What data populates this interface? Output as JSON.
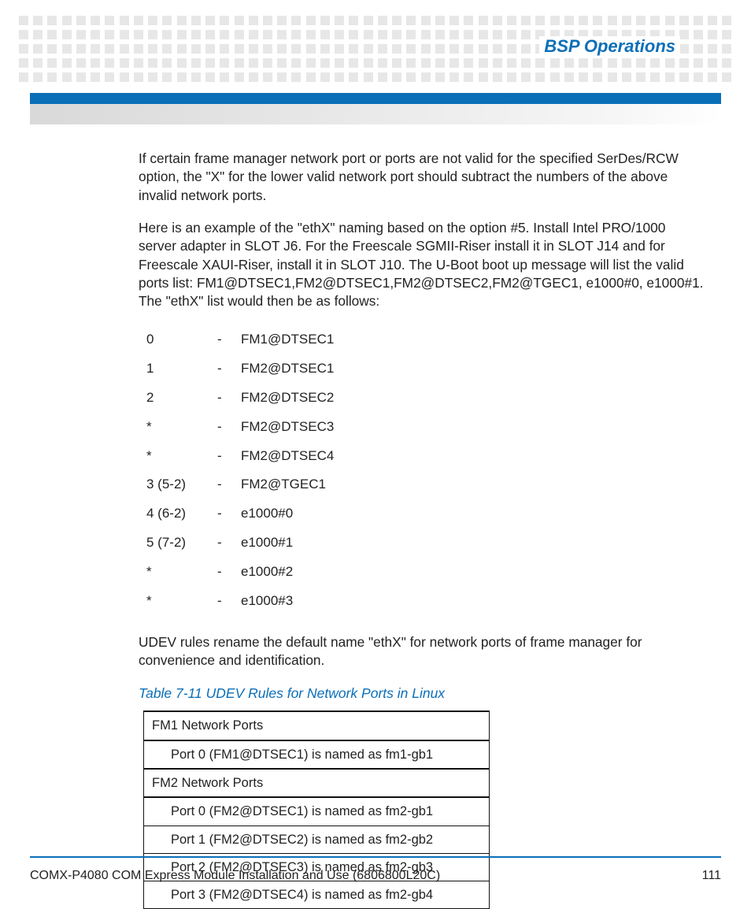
{
  "header": {
    "title": "BSP Operations"
  },
  "body": {
    "para1": "If certain frame manager network port or ports are not valid for the specified SerDes/RCW option, the \"X\" for the lower valid network port should subtract the numbers of the above invalid network ports.",
    "para2": "Here is an example of the \"ethX\" naming based on the option #5. Install Intel PRO/1000 server adapter in SLOT J6. For the Freescale SGMII-Riser install it in SLOT J14 and for Freescale XAUI-Riser, install it in SLOT J10. The U-Boot boot up message will list the valid ports list: FM1@DTSEC1,FM2@DTSEC1,FM2@DTSEC2,FM2@TGEC1, e1000#0, e1000#1. The \"ethX\" list would then be as follows:",
    "map": [
      {
        "idx": "0",
        "port": "FM1@DTSEC1"
      },
      {
        "idx": "1",
        "port": "FM2@DTSEC1"
      },
      {
        "idx": "2",
        "port": "FM2@DTSEC2"
      },
      {
        "idx": " *",
        "port": "FM2@DTSEC3"
      },
      {
        "idx": " *",
        "port": "FM2@DTSEC4"
      },
      {
        "idx": "3 (5-2)",
        "port": "FM2@TGEC1"
      },
      {
        "idx": "4 (6-2)",
        "port": "e1000#0"
      },
      {
        "idx": "5 (7-2)",
        "port": "e1000#1"
      },
      {
        "idx": " *",
        "port": "e1000#2"
      },
      {
        "idx": " *",
        "port": "e1000#3"
      }
    ],
    "para3": "UDEV rules rename the default name \"ethX\" for network ports of frame manager for convenience and identification.",
    "table_caption": "Table 7-11 UDEV Rules for Network Ports in Linux",
    "udev_rows": [
      {
        "type": "header",
        "text": "FM1 Network Ports"
      },
      {
        "type": "sub",
        "text": "Port 0 (FM1@DTSEC1) is named as fm1-gb1"
      },
      {
        "type": "header",
        "text": "FM2 Network Ports"
      },
      {
        "type": "sub",
        "text": "Port 0 (FM2@DTSEC1) is named as fm2-gb1"
      },
      {
        "type": "sub",
        "text": "Port 1 (FM2@DTSEC2) is named as fm2-gb2"
      },
      {
        "type": "sub",
        "text": "Port 2 (FM2@DTSEC3) is named as fm2-gb3"
      },
      {
        "type": "sub",
        "text": "Port 3 (FM2@DTSEC4) is named as fm2-gb4"
      }
    ]
  },
  "footer": {
    "left": "COMX-P4080 COM Express Module Installation and Use (6806800L20C)",
    "right": "111"
  },
  "dash": "-"
}
